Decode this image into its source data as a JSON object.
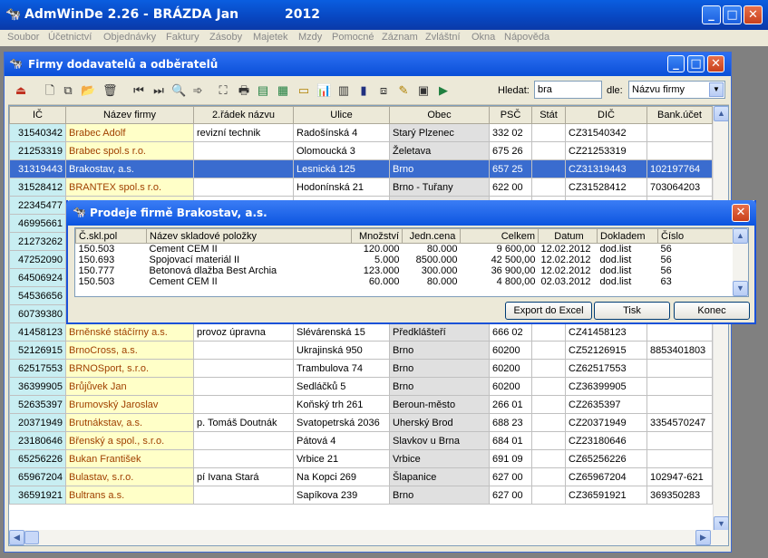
{
  "app": {
    "title": "AdmWinDe 2.26 - BRÁZDA Jan",
    "year": "2012"
  },
  "menu": [
    "Soubor",
    "Účetnictví",
    "Objednávky",
    "Faktury",
    "Zásoby",
    "Majetek",
    "Mzdy",
    "Pomocné",
    "Záznam",
    "Zvláštní",
    "Okna",
    "Nápověda"
  ],
  "child": {
    "title": "Firmy dodavatelů a odběratelů"
  },
  "search": {
    "label": "Hledat:",
    "value": "bra",
    "by_label": "dle:",
    "by_value": "Názvu firmy"
  },
  "grid": {
    "headers": [
      "IČ",
      "Název firmy",
      "2.řádek názvu",
      "Ulice",
      "Obec",
      "PSČ",
      "Stát",
      "DIČ",
      "Bank.účet"
    ],
    "rows": [
      [
        "31540342",
        "Brabec Adolf",
        "revizní technik",
        "Radošínská 4",
        "Starý Plzenec",
        "332 02",
        "",
        "CZ31540342",
        ""
      ],
      [
        "21253319",
        "Brabec spol.s r.o.",
        "",
        "Olomoucká 3",
        "Želetava",
        "675 26",
        "",
        "CZ21253319",
        ""
      ],
      [
        "31319443",
        "Brakostav, a.s.",
        "",
        "Lesnická 125",
        "Brno",
        "657 25",
        "",
        "CZ31319443",
        "102197764"
      ],
      [
        "31528412",
        "BRANTEX spol.s r.o.",
        "",
        "Hodonínská 21",
        "Brno - Tuřany",
        "622 00",
        "",
        "CZ31528412",
        "703064203"
      ],
      [
        "22345477",
        "",
        "",
        "",
        "",
        "",
        "",
        "",
        ""
      ],
      [
        "46995661",
        "",
        "",
        "",
        "",
        "",
        "",
        "",
        ""
      ],
      [
        "21273262",
        "",
        "",
        "",
        "",
        "",
        "",
        "",
        ""
      ],
      [
        "47252090",
        "",
        "",
        "",
        "",
        "",
        "",
        "",
        ""
      ],
      [
        "64506924",
        "",
        "",
        "",
        "",
        "",
        "",
        "",
        ""
      ],
      [
        "54536656",
        "",
        "",
        "",
        "",
        "",
        "",
        "",
        ""
      ],
      [
        "60739380",
        "",
        "",
        "",
        "",
        "",
        "",
        "",
        ""
      ],
      [
        "41458123",
        "Brněnské stáčírny a.s.",
        "provoz úpravna",
        "Slévárenská 15",
        "Předklášteří",
        "666 02",
        "",
        "CZ41458123",
        ""
      ],
      [
        "52126915",
        "BrnoCross, a.s.",
        "",
        "Ukrajinská 950",
        "Brno",
        "60200",
        "",
        "CZ52126915",
        "8853401803"
      ],
      [
        "62517553",
        "BRNOSport, s.r.o.",
        "",
        "Trambulova 74",
        "Brno",
        "60200",
        "",
        "CZ62517553",
        ""
      ],
      [
        "36399905",
        "Brůjůvek Jan",
        "",
        "Sedláčků 5",
        "Brno",
        "60200",
        "",
        "CZ36399905",
        ""
      ],
      [
        "52635397",
        "Brumovský Jaroslav",
        "",
        "Koňský trh 261",
        "Beroun-město",
        "266 01",
        "",
        "CZ2635397",
        ""
      ],
      [
        "20371949",
        "Brutnákstav, a.s.",
        "p. Tomáš Doutnák",
        "Svatopetrská 2036",
        "Uherský Brod",
        "688 23",
        "",
        "CZ20371949",
        "3354570247"
      ],
      [
        "23180646",
        "Břenský a spol., s.r.o.",
        "",
        "Pátová 4",
        "Slavkov u Brna",
        "684 01",
        "",
        "CZ23180646",
        ""
      ],
      [
        "65256226",
        "Bukan František",
        "",
        "Vrbice 21",
        "Vrbice",
        "691 09",
        "",
        "CZ65256226",
        ""
      ],
      [
        "65967204",
        "Bulastav, s.r.o.",
        "pí Ivana Stará",
        "Na Kopci 269",
        "Šlapanice",
        "627 00",
        "",
        "CZ65967204",
        "102947-621"
      ],
      [
        "36591921",
        "Bultrans a.s.",
        "",
        "Sapíkova 239",
        "Brno",
        "627 00",
        "",
        "CZ36591921",
        "369350283"
      ]
    ]
  },
  "dialog": {
    "title": "Prodeje firmě Brakostav, a.s.",
    "headers": [
      "Č.skl.pol",
      "Název skladové položky",
      "Množství",
      "Jedn.cena",
      "Celkem",
      "Datum",
      "Dokladem",
      "Číslo"
    ],
    "rows": [
      [
        "150.503",
        "Cement CEM II",
        "120.000",
        "80.000",
        "9 600,00",
        "12.02.2012",
        "dod.list",
        "56"
      ],
      [
        "150.693",
        "Spojovací materiál II",
        "5.000",
        "8500.000",
        "42 500,00",
        "12.02.2012",
        "dod.list",
        "56"
      ],
      [
        "150.777",
        "Betonová dlažba Best Archia",
        "123.000",
        "300.000",
        "36 900,00",
        "12.02.2012",
        "dod.list",
        "56"
      ],
      [
        "150.503",
        "Cement CEM II",
        "60.000",
        "80.000",
        "4 800,00",
        "02.03.2012",
        "dod.list",
        "63"
      ]
    ],
    "buttons": {
      "export": "Export do Excel",
      "print": "Tisk",
      "close": "Konec"
    }
  }
}
